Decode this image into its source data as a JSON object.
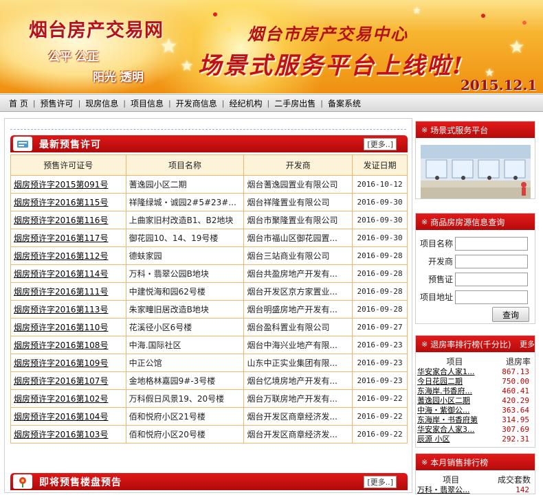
{
  "banner": {
    "site_title": "烟台房产交易网",
    "slogan_1": "公平 公正",
    "slogan_2": "阳光 透明",
    "org": "烟台市房产交易中心",
    "headline": "场景式服务平台上线啦!",
    "date": "2015.12.1"
  },
  "nav": {
    "items": [
      "首 页",
      "预售许可",
      "现房信息",
      "项目信息",
      "开发商信息",
      "经纪机构",
      "二手房出售",
      "备案系统"
    ]
  },
  "permits": {
    "title": "最新预售许可",
    "more": "[更多..]",
    "headers": [
      "预售许可证号",
      "项目名称",
      "开发商",
      "发证日期"
    ],
    "rows": [
      [
        "烟房预许字2015第091号",
        "蓍逸园小区二期",
        "烟台蓍逸园置业有限公司",
        "2016-10-12"
      ],
      [
        "烟房预许字2016第115号",
        "祥隆绿城・诚园2#5#23#...",
        "烟台祥隆置业有限公司",
        "2016-09-30"
      ],
      [
        "烟房预许字2016第116号",
        "上曲家旧村改造B1、B2地块",
        "烟台市聚隆置业有限公司",
        "2016-09-30"
      ],
      [
        "烟房预许字2016第117号",
        "御花园10、14、19号楼",
        "烟台市福山区御花园置...",
        "2016-09-30"
      ],
      [
        "烟房预许字2016第112号",
        "德蚨家园",
        "烟台三站商业有限公司",
        "2016-09-28"
      ],
      [
        "烟房预许字2016第114号",
        "万科・翡翠公园B地块",
        "烟台共盈房地产开发有...",
        "2016-09-28"
      ],
      [
        "烟房预许字2016第111号",
        "中建悦海和园62号楼",
        "烟台开发区京方家置业...",
        "2016-09-28"
      ],
      [
        "烟房预许字2016第113号",
        "朱家疃旧居改造B地块",
        "烟台明盛房地产开发有...",
        "2016-09-28"
      ],
      [
        "烟房预许字2016第110号",
        "花溪径小区6号楼",
        "烟台盈科置业有限公司",
        "2016-09-27"
      ],
      [
        "烟房预许字2016第108号",
        "中海.国际社区",
        "烟台中海兴业地产有限...",
        "2016-09-23"
      ],
      [
        "烟房预许字2016第109号",
        "中正公馆",
        "山东中正实业集团有限...",
        "2016-09-23"
      ],
      [
        "烟房预许字2016第107号",
        "金地格林嘉园9#-3号楼",
        "烟台忆境房地产开发有...",
        "2016-09-23"
      ],
      [
        "烟房预许字2016第102号",
        "万科假日风景19、20号楼",
        "烟台万联房地产开发有...",
        "2016-09-22"
      ],
      [
        "烟房预许字2016第104号",
        "佰和悦府小区21号楼",
        "烟台开发区商章经济发...",
        "2016-09-22"
      ],
      [
        "烟房预许字2016第103号",
        "佰和悦府小区20号楼",
        "烟台开发区商章经济发...",
        "2016-09-22"
      ]
    ]
  },
  "upcoming": {
    "title": "即将预售楼盘预告",
    "more": "[更多..]"
  },
  "scene_service": {
    "title": "场景式服务平台"
  },
  "search": {
    "title": "商品房房源信息查询",
    "labels": [
      "项目名称",
      "开发商",
      "预售证",
      "项目地址"
    ],
    "button": "查询"
  },
  "refund_rank": {
    "title": "退房率排行榜(千分比)",
    "more": "更多",
    "headers": [
      "项目",
      "退房率"
    ],
    "rows": [
      [
        "华安家合人家1...",
        "867.13"
      ],
      [
        "今日花园二期",
        "750.00"
      ],
      [
        "东海岸.书香府...",
        "460.41"
      ],
      [
        "蓍逸园小区二期",
        "420.29"
      ],
      [
        "中海・紫御公...",
        "363.64"
      ],
      [
        "东海岸・书香府第",
        "314.95"
      ],
      [
        "华安家合人家3...",
        "307.69"
      ],
      [
        "辰源 小区",
        "292.31"
      ]
    ]
  },
  "monthly_sales": {
    "title": "本月销售排行榜",
    "headers": [
      "项目",
      "成交套数"
    ],
    "rows": [
      [
        "万科・翡翠公...",
        "142"
      ]
    ]
  },
  "colors": {
    "accent_red": "#c8101a",
    "table_border": "#f2b56a",
    "table_header": "#fdf3d8"
  }
}
